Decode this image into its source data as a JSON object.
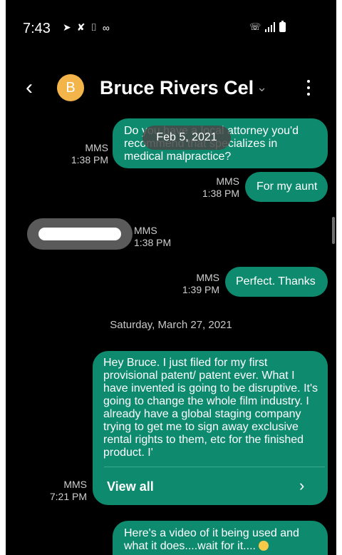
{
  "status_bar": {
    "time": "7:43",
    "icons": [
      "send-icon",
      "missed-call-icon",
      "screenshot-icon",
      "voicemail-icon"
    ],
    "right_icons": [
      "wifi-calling-icon",
      "signal-icon",
      "battery-icon"
    ]
  },
  "header": {
    "avatar_letter": "B",
    "contact_name": "Bruce Rivers Cel",
    "avatar_color": "#f3b54a"
  },
  "date_pill": "Feb 5, 2021",
  "messages": [
    {
      "text": "Do you have a local attorney you'd recommend that specializes in medical malpractice?",
      "type": "MMS",
      "time": "1:38 PM"
    },
    {
      "text": "For my aunt",
      "type": "MMS",
      "time": "1:38 PM"
    },
    {
      "text": "",
      "type": "MMS",
      "time": "1:38 PM"
    },
    {
      "text": "Perfect. Thanks",
      "type": "MMS",
      "time": "1:39 PM"
    },
    {
      "text": "Hey Bruce. I just filed for my first provisional patent/ patent ever.  What I have invented is going to be disruptive. It's going to change the whole film industry. I already have a global staging company trying to get me to sign away exclusive rental rights to them, etc for the finished product. I'",
      "type": "MMS",
      "time": "7:21 PM",
      "view_all": "View all"
    },
    {
      "text": "Here's a video of it being used and what it does....wait for it....",
      "type": "",
      "time": ""
    }
  ],
  "day_separator": "Saturday, March 27, 2021",
  "colors": {
    "bubble": "#0e8a6f",
    "background": "#000000"
  }
}
